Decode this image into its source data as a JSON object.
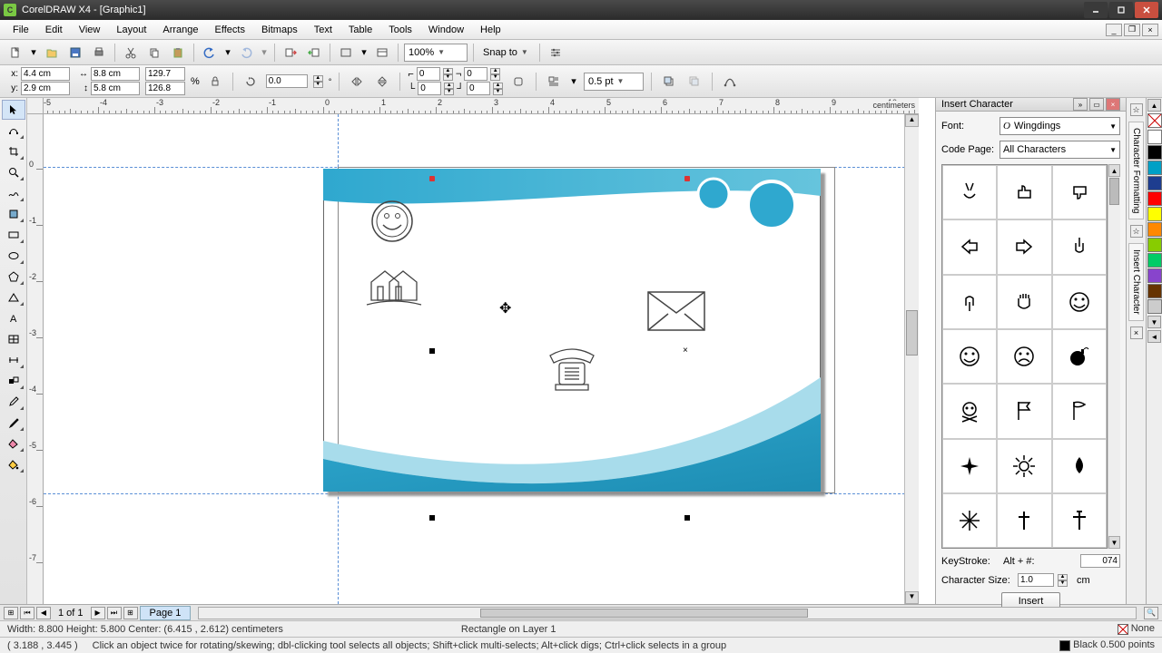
{
  "app": {
    "title": "CorelDRAW X4 - [Graphic1]"
  },
  "menu": [
    "File",
    "Edit",
    "View",
    "Layout",
    "Arrange",
    "Effects",
    "Bitmaps",
    "Text",
    "Table",
    "Tools",
    "Window",
    "Help"
  ],
  "toolbar": {
    "zoom_value": "100%",
    "snap_label": "Snap to"
  },
  "propbar": {
    "x": "4.4 cm",
    "y": "2.9 cm",
    "w": "8.8 cm",
    "h": "5.8 cm",
    "scale_x": "129.7",
    "scale_y": "126.8",
    "scale_unit": "%",
    "rotate": "0.0",
    "corner_tl": "0",
    "corner_tr": "0",
    "corner_bl": "0",
    "corner_br": "0",
    "outline_width": "0.5 pt"
  },
  "ruler_unit": "centimeters",
  "pagenav": {
    "counter": "1 of 1",
    "tab": "Page 1"
  },
  "status1": {
    "dims": "Width: 8.800   Height: 5.800   Center: (6.415 , 2.612)  centimeters",
    "obj": "Rectangle on Layer 1",
    "fill_label": "None",
    "outline_label": "Black   0.500 points"
  },
  "status2": {
    "cursor": "( 3.188 , 3.445 )",
    "hint": "Click an object twice for rotating/skewing; dbl-clicking tool selects all objects; Shift+click multi-selects; Alt+click digs; Ctrl+click selects in a group"
  },
  "docker": {
    "title": "Insert Character",
    "font_label": "Font:",
    "font_value": "Wingdings",
    "codepage_label": "Code Page:",
    "codepage_value": "All Characters",
    "keystroke_label": "KeyStroke:",
    "keystroke_prefix": "Alt  +  #:",
    "keystroke_value": "074",
    "size_label": "Character Size:",
    "size_value": "1.0",
    "size_unit": "cm",
    "insert_label": "Insert",
    "chars": [
      "✌",
      "👍",
      "👎",
      "👈",
      "👉",
      "☝",
      "👇",
      "✋",
      "☺",
      "☺",
      "☹",
      "💣",
      "☠",
      "⚐",
      "⚑",
      "✈",
      "☼",
      "💧",
      "❄",
      "✝",
      "✞"
    ]
  },
  "palette_colors": [
    "#ffffff",
    "#000000",
    "#00a0c6",
    "#1e3d8f",
    "#ff0000",
    "#ffff00",
    "#ff8800",
    "#88cc00",
    "#00cc66",
    "#8844cc",
    "#663300",
    "#cccccc"
  ],
  "tabs": [
    "Character Formatting",
    "Insert Character"
  ]
}
